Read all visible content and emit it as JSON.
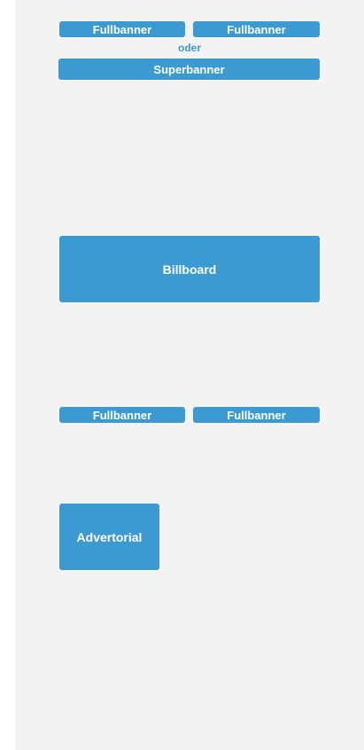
{
  "colors": {
    "accent": "#3b9ad2",
    "panel_background": "#f3f3f3",
    "label_text": "#ffffff"
  },
  "layout_slots": {
    "top_row": {
      "left_label": "Fullbanner",
      "right_label": "Fullbanner",
      "separator": "oder",
      "wide_label": "Superbanner"
    },
    "billboard_label": "Billboard",
    "middle_row": {
      "left_label": "Fullbanner",
      "right_label": "Fullbanner"
    },
    "advertorial_label": "Advertorial"
  }
}
